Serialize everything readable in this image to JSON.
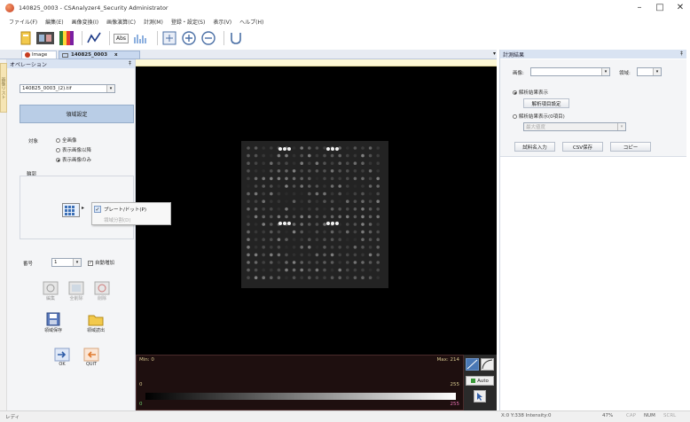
{
  "window": {
    "title": "140825_0003 - CSAnalyzer4_Security Administrator",
    "controls": [
      "–",
      "□",
      "✕"
    ]
  },
  "menu": [
    "ファイル(F)",
    "編集(E)",
    "画像変換(I)",
    "画像演算(C)",
    "計測(M)",
    "登録・設定(S)",
    "表示(V)",
    "ヘルプ(H)"
  ],
  "toolbar": {
    "abs_label": "Abs"
  },
  "tabs": {
    "image_tab": "Image",
    "doc_tab": "140825_0003",
    "close": "x"
  },
  "side_rail": {
    "label": "画像リスト"
  },
  "operation": {
    "header": "オペレーション",
    "file_select": "140825_0003_(2).tif",
    "section_button": "領域設定",
    "target_label": "対象",
    "target_options": [
      "全画像",
      "表示画像以降",
      "表示画像のみ"
    ],
    "target_selected": 2,
    "frame_label": "輪郭",
    "number_label": "番号",
    "number_value": "1",
    "auto_increment_label": "自動増加",
    "auto_increment_checked": true,
    "edit_tools": [
      "編集",
      "全削除",
      "削除"
    ],
    "file_buttons": [
      "領域保存",
      "領域読出"
    ],
    "ok_label": "OK",
    "quit_label": "QUIT"
  },
  "context_menu": {
    "items": [
      "プレート/ドット(P)",
      "領域分割(D)"
    ],
    "checked": 0,
    "disabled": [
      1
    ]
  },
  "histogram": {
    "min_label": "Min:",
    "min_value": "0",
    "max_label": "Max:",
    "max_value": "214",
    "scale_low": "0",
    "scale_high": "255",
    "bottom_left": "0",
    "bottom_right": "255",
    "auto_label": "Auto"
  },
  "results": {
    "header": "計測結果",
    "image_label": "画像:",
    "image_value": "",
    "region_label": "領域:",
    "region_value": "",
    "option_show": "解析結果表示",
    "option_show_selected": true,
    "settings_button": "解析項目設定",
    "option_show_after": "解析結果表示(0項目)",
    "max_label": "最大値度",
    "buttons": [
      "試料名入力",
      "CSV保存",
      "コピー"
    ]
  },
  "status": {
    "ready": "レディ",
    "coords": "X:0 Y:338 Intensity:0",
    "zoom": "47%",
    "indicators": [
      "CAP",
      "NUM",
      "SCRL"
    ]
  },
  "colors": {
    "panel_header": "#d9e3f2",
    "section_button": "#b9cde6",
    "image_bg": "#000000",
    "tab_active": "#c8d8ef"
  }
}
